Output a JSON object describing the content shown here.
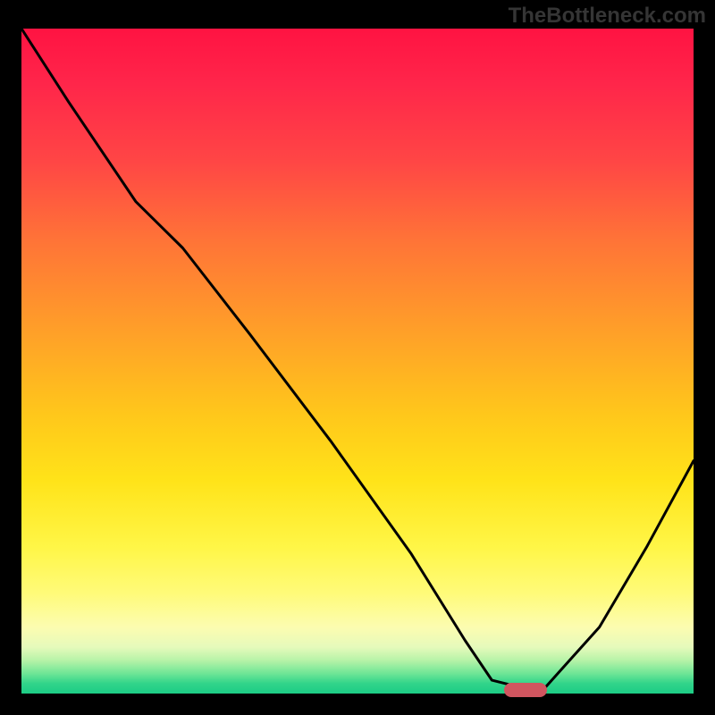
{
  "watermark": "TheBottleneck.com",
  "chart_data": {
    "type": "line",
    "title": "",
    "xlabel": "",
    "ylabel": "",
    "x": [
      0.0,
      0.07,
      0.17,
      0.24,
      0.34,
      0.46,
      0.58,
      0.66,
      0.7,
      0.74,
      0.78,
      0.86,
      0.93,
      1.0
    ],
    "y": [
      1.0,
      0.89,
      0.74,
      0.67,
      0.54,
      0.38,
      0.21,
      0.08,
      0.02,
      0.01,
      0.01,
      0.1,
      0.22,
      0.35
    ],
    "xlim": [
      0,
      1
    ],
    "ylim": [
      0,
      1
    ],
    "gradient_background": {
      "top": "#ff1342",
      "mid": "#ffe319",
      "bottom": "#1ccc85"
    },
    "marker": {
      "x_center": 0.75,
      "y": 0.005,
      "color": "#d0555f"
    }
  }
}
